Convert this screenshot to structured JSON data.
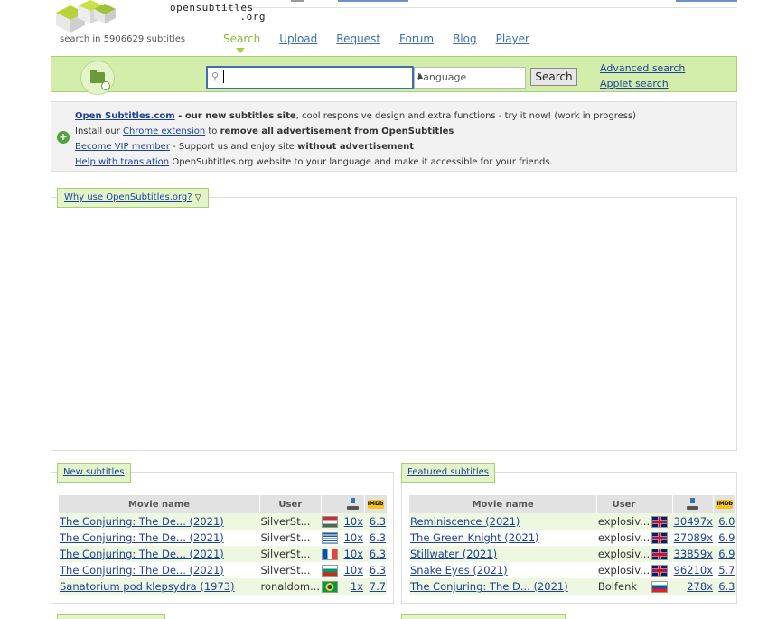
{
  "header": {
    "logo_line1": "opensubtitles",
    "logo_line2": ".org",
    "search_count": "search in 5906629 subtitles",
    "nav": [
      {
        "label": "Search"
      },
      {
        "label": "Upload"
      },
      {
        "label": "Request"
      },
      {
        "label": "Forum"
      },
      {
        "label": "Blog"
      },
      {
        "label": "Player"
      }
    ]
  },
  "search": {
    "value": "",
    "language": "Language",
    "button": "Search",
    "advanced": "Advanced search",
    "applet": "Applet search"
  },
  "info": {
    "l1_link": "Open Subtitles.com",
    "l1_bold": " - our new subtitles site",
    "l1_rest": ", cool responsive design and extra functions - try it now! (work in progress)",
    "l2_pre": "Install our ",
    "l2_link": "Chrome extension",
    "l2_mid": " to ",
    "l2_bold": "remove all advertisement from OpenSubtitles",
    "l3_link": "Become VIP member",
    "l3_mid": " - Support us and enjoy site ",
    "l3_bold": "without advertisement",
    "l4_link": "Help with translation",
    "l4_rest": " OpenSubtitles.org website to your language and make it accessible for your friends."
  },
  "why": {
    "label": "Why use OpenSubtitles.org?"
  },
  "new_subtitles": {
    "title": "New subtitles",
    "headers": {
      "movie": "Movie name",
      "user": "User"
    },
    "rows": [
      {
        "movie": "The Conjuring: The De... (2021)",
        "user": "SilverSt...",
        "flag": "hu",
        "dl": "10x",
        "imdb": "6.3"
      },
      {
        "movie": "The Conjuring: The De... (2021)",
        "user": "SilverSt...",
        "flag": "gr",
        "dl": "10x",
        "imdb": "6.3"
      },
      {
        "movie": "The Conjuring: The De... (2021)",
        "user": "SilverSt...",
        "flag": "fr",
        "dl": "10x",
        "imdb": "6.3"
      },
      {
        "movie": "The Conjuring: The De... (2021)",
        "user": "SilverSt...",
        "flag": "bg",
        "dl": "10x",
        "imdb": "6.3"
      },
      {
        "movie": "Sanatorium pod klepsydra (1973)",
        "user": "ronaldom...",
        "flag": "br",
        "dl": "1x",
        "imdb": "7.7"
      }
    ]
  },
  "featured_subtitles": {
    "title": "Featured subtitles",
    "headers": {
      "movie": "Movie name",
      "user": "User"
    },
    "rows": [
      {
        "movie": "Reminiscence (2021)",
        "user": "explosiv...",
        "flag": "gb",
        "dl": "30497x",
        "imdb": "6.0"
      },
      {
        "movie": "The Green Knight (2021)",
        "user": "explosiv...",
        "flag": "gb",
        "dl": "27089x",
        "imdb": "6.9"
      },
      {
        "movie": "Stillwater (2021)",
        "user": "explosiv...",
        "flag": "gb",
        "dl": "33859x",
        "imdb": "6.9"
      },
      {
        "movie": "Snake Eyes (2021)",
        "user": "explosiv...",
        "flag": "gb",
        "dl": "96210x",
        "imdb": "5.7"
      },
      {
        "movie": "The Conjuring: The D... (2021)",
        "user": "Bolfenk",
        "flag": "si",
        "dl": "278x",
        "imdb": "6.3"
      }
    ]
  },
  "icons": {
    "download": "download-icon",
    "imdb": "imdb-icon",
    "imdb_text": "IMDb"
  },
  "colors": {
    "accent_green": "#d3eeaa",
    "link_blue": "#1c3f9e",
    "row_alt": "#eef7e0"
  }
}
